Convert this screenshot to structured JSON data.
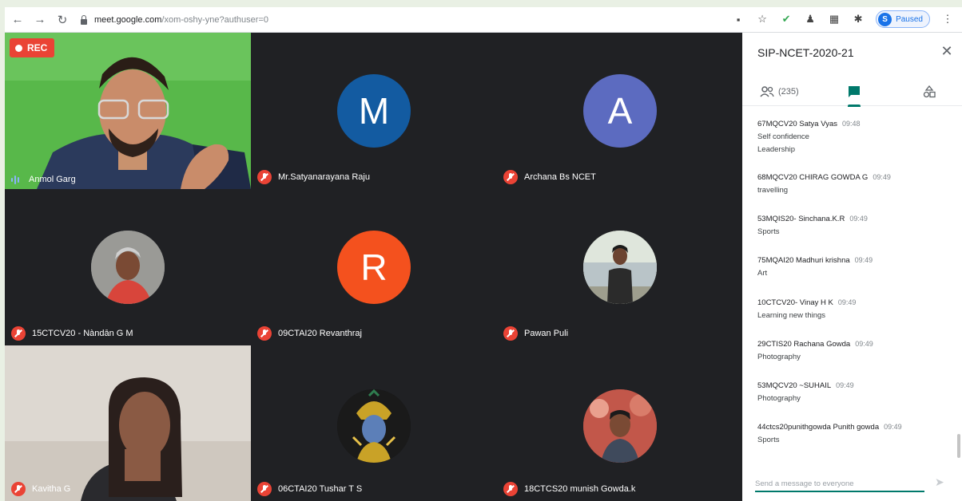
{
  "browser": {
    "url_host": "meet.google.com",
    "url_path": "/xom-oshy-yne?authuser=0",
    "profile_initial": "S",
    "profile_status": "Paused"
  },
  "recording": {
    "label": "REC"
  },
  "tiles": [
    {
      "name": "Anmol Garg",
      "kind": "video",
      "speaking": true
    },
    {
      "name": "Mr.Satyanarayana Raju",
      "kind": "letter",
      "letter": "M",
      "color": "#135ba1"
    },
    {
      "name": "Archana Bs NCET",
      "kind": "letter",
      "letter": "A",
      "color": "#5c6bc0"
    },
    {
      "name": "15CTCV20 - Nàndān G M",
      "kind": "photo"
    },
    {
      "name": "09CTAI20 Revanthraj",
      "kind": "letter",
      "letter": "R",
      "color": "#f4511e"
    },
    {
      "name": "Pawan Puli",
      "kind": "photo"
    },
    {
      "name": "Kavitha G",
      "kind": "video"
    },
    {
      "name": "06CTAI20 Tushar T S",
      "kind": "photo"
    },
    {
      "name": "18CTCS20 munish Gowda.k",
      "kind": "photo"
    }
  ],
  "panel": {
    "title": "SIP-NCET-2020-21",
    "people_count": "(235)",
    "compose_placeholder": "Send a message to everyone"
  },
  "messages": [
    {
      "sender": "67MQCV20 Satya Vyas",
      "time": "09:48",
      "lines": [
        "Self confidence",
        "Leadership"
      ]
    },
    {
      "sender": "68MQCV20 CHIRAG GOWDA G",
      "time": "09:49",
      "lines": [
        "travelling"
      ]
    },
    {
      "sender": "53MQIS20- Sinchana.K.R",
      "time": "09:49",
      "lines": [
        "Sports"
      ]
    },
    {
      "sender": "75MQAI20 Madhuri krishna",
      "time": "09:49",
      "lines": [
        "Art"
      ]
    },
    {
      "sender": "10CTCV20- Vinay H K",
      "time": "09:49",
      "lines": [
        "Learning new things"
      ]
    },
    {
      "sender": "29CTIS20 Rachana Gowda",
      "time": "09:49",
      "lines": [
        "Photography"
      ]
    },
    {
      "sender": "53MQCV20 ~SUHAIL",
      "time": "09:49",
      "lines": [
        "Photography"
      ]
    },
    {
      "sender": "44ctcs20punithgowda Punith gowda",
      "time": "09:49",
      "lines": [
        "Sports"
      ]
    }
  ]
}
